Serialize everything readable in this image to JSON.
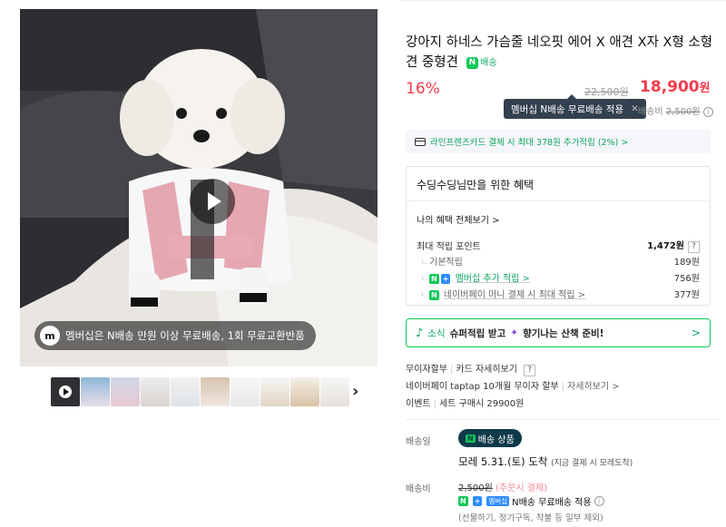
{
  "media": {
    "membership_text": "멤버십은 N배송 만원 이상 무료배송, 1회 무료교환반품",
    "membership_icon": "membership-m-icon",
    "play_icon": "play-icon",
    "next_icon": "chevron-right-icon",
    "next_glyph": "›",
    "thumb_count": 10
  },
  "product": {
    "title": "강아지 하네스 가슴줄 네오핏 에어 X 애견 X자 X형 소형견 중형견",
    "delivery_badge_n": "N",
    "delivery_badge": "배송",
    "discount": "16%",
    "original_price": "22,500원",
    "sale_price": "18,900",
    "sale_unit": "원"
  },
  "tooltip": {
    "text": "멤버십 N배송 무료배송 적용",
    "close": "✕"
  },
  "shipping_top": {
    "label": "배송비",
    "fee": "2,500원",
    "info": "i"
  },
  "card_promo": {
    "text": "라인프렌즈카드 결제 시 최대 378원 추가적립 (2%) >"
  },
  "benefits": {
    "header": "수딩수딩님만을 위한 혜택",
    "all_link": "나의 혜택 전체보기 >",
    "max_label": "최대 적립 포인트",
    "max_value": "1,472원",
    "help": "?",
    "rows": [
      {
        "label": "기본적립",
        "value": "189원"
      },
      {
        "label": "멤버십 추가 적립 >",
        "value": "756원"
      },
      {
        "label": "네이버페이 머니 결제 시 최대 적립 >",
        "value": "377원"
      }
    ],
    "tag_n": "N",
    "tag_plus": "+"
  },
  "event": {
    "text_pre": "소식",
    "text_bold1": "슈퍼적립 받고",
    "text_bold2": "향기나는 산책 준비!",
    "chevron": ">"
  },
  "payment": {
    "line1_a": "무이자할부",
    "line1_b": "카드 자세히보기",
    "line1_help": "?",
    "line2_a": "네이버페이 taptap 10개월 무이자 할부",
    "line2_b": "자세히보기 >",
    "line3_a": "이벤트",
    "line3_b": "세트 구매시 29900원"
  },
  "delivery": {
    "date_label": "배송일",
    "badge_n": "N",
    "badge": "배송 상품",
    "arrive": "모레 5.31.(토) 도착",
    "arrive_note": "(지금 결제 시 모레도착)",
    "fee_label": "배송비",
    "fee": "2,500원",
    "fee_cond": "(주문시 결제)",
    "nfree_n": "N",
    "nfree_plus": "+",
    "nfree_member": "멤버십",
    "nfree_text": "N배송 무료배송 적용",
    "exclusion": "(선물하기, 정기구독, 착불 등 일부 제외)"
  },
  "colors": {
    "discount": "#f23c4c",
    "naver_green": "#10c85a",
    "tooltip_bg": "#33404f"
  }
}
